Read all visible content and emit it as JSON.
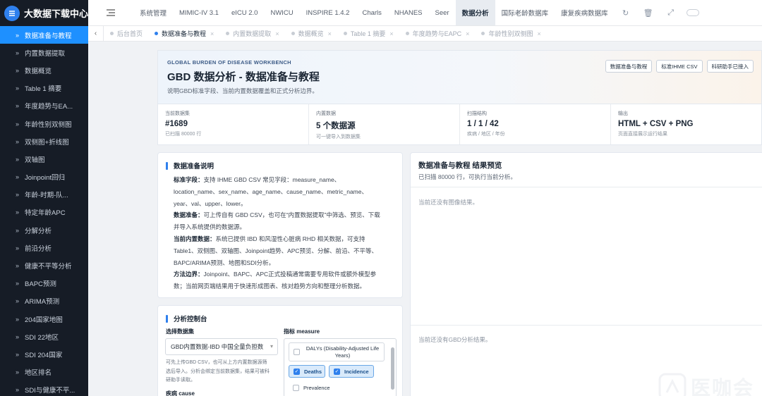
{
  "app": {
    "title": "大数据下载中心"
  },
  "sidebar": {
    "items": [
      {
        "label": "数据准备与教程",
        "active": true
      },
      {
        "label": "内置数据提取"
      },
      {
        "label": "数据概览"
      },
      {
        "label": "Table 1 摘要"
      },
      {
        "label": "年度趋势与EA..."
      },
      {
        "label": "年龄性别双侧图"
      },
      {
        "label": "双侧图+折线图"
      },
      {
        "label": "双轴图"
      },
      {
        "label": "Joinpoint回归"
      },
      {
        "label": "年龄-时期-队..."
      },
      {
        "label": "特定年龄APC"
      },
      {
        "label": "分解分析"
      },
      {
        "label": "前沿分析"
      },
      {
        "label": "健康不平等分析"
      },
      {
        "label": "BAPC预测"
      },
      {
        "label": "ARIMA预测"
      },
      {
        "label": "204国家地图"
      },
      {
        "label": "SDI 22地区"
      },
      {
        "label": "SDI 204国家"
      },
      {
        "label": "地区排名"
      },
      {
        "label": "SDI与健康不平..."
      }
    ]
  },
  "topnav": {
    "items": [
      {
        "label": "系统管理"
      },
      {
        "label": "MIMIC-IV 3.1"
      },
      {
        "label": "eICU 2.0"
      },
      {
        "label": "NWICU"
      },
      {
        "label": "INSPIRE 1.4.2"
      },
      {
        "label": "Charls"
      },
      {
        "label": "NHANES"
      },
      {
        "label": "Seer"
      },
      {
        "label": "数据分析",
        "active": true
      },
      {
        "label": "国际老龄数据库"
      },
      {
        "label": "康复疾病数据库"
      }
    ]
  },
  "tabs": [
    {
      "label": "后台首页"
    },
    {
      "label": "数据准备与教程",
      "active": true
    },
    {
      "label": "内置数据提取"
    },
    {
      "label": "数据概览"
    },
    {
      "label": "Table 1 摘要"
    },
    {
      "label": "年度趋势与EAPC"
    },
    {
      "label": "年龄性别双侧图"
    }
  ],
  "hero": {
    "eyebrow": "GLOBAL BURDEN OF DISEASE WORKBENCH",
    "title": "GBD 数据分析 - 数据准备与教程",
    "subtitle": "说明GBD标准字段、当前内置数据覆盖和正式分析边界。",
    "buttons": [
      "数据准备与教程",
      "标准IHME CSV",
      "科研助手已接入"
    ]
  },
  "stats": [
    {
      "label": "当前数据集",
      "value": "#1689",
      "note": "已扫描 80000 行"
    },
    {
      "label": "内置数据",
      "value": "5 个数据源",
      "note": "可一键导入到数据集"
    },
    {
      "label": "扫描结构",
      "value": "1 / 1 / 42",
      "note": "疾病 / 地区 / 年份"
    },
    {
      "label": "输出",
      "value": "HTML + CSV + PNG",
      "note": "页面直接展示运行结果"
    }
  ],
  "notes": {
    "title": "数据准备说明",
    "p1_head": "标准字段：",
    "p1_l1": "支持 IHME GBD CSV 常见字段：measure_name、",
    "p1_l2": "location_name、sex_name、age_name、cause_name、metric_name、",
    "p1_l3": "year、val、upper、lower。",
    "p2_head": "数据准备：",
    "p2_l1": "可上传自有 GBD CSV，也可在“内置数据提取”中筛选、预览、下载",
    "p2_l2": "并导入系统提供的数据源。",
    "p3_head": "当前内置数据：",
    "p3_l1": "系统已提供 IBD 和风湿性心脏病 RHD 相关数据，可支持",
    "p3_l2": "Table1、双侧图、双轴图、Joinpoint趋势、APC预览、分解、前沿、不平等、",
    "p3_l3": "BAPC/ARIMA预测、地图和SDI分析。",
    "p4_head": "方法边界：",
    "p4_l1": "Joinpoint、BAPC、APC正式投稿通常需要专用软件或额外模型参",
    "p4_l2": "数；当前网页端结果用于快速形成图表、核对趋势方向和整理分析数据。"
  },
  "control": {
    "title": "分析控制台",
    "dataset_label": "选择数据集",
    "dataset_value": "GBD内置数据-IBD 中国全量负担数",
    "dataset_hint": [
      "可先上传GBD CSV，也可从上方内置数据源筛",
      "选后导入。分析会绑定当前数据集，结果可被科",
      "研助手读取。"
    ],
    "cause_label": "疾病 cause",
    "metric_label": "指标 measure",
    "metrics": [
      {
        "label": "DALYs (Disability-Adjusted Life Years)",
        "checked": false
      },
      {
        "label": "Deaths",
        "checked": true
      },
      {
        "label": "Incidence",
        "checked": true
      },
      {
        "label": "Prevalence",
        "checked": false
      }
    ]
  },
  "preview": {
    "title": "数据准备与教程 结果预览",
    "subtitle": "已扫描 80000 行，可执行当前分析。",
    "empty_image": "当前还没有图像结果。",
    "empty_result": "当前还没有GBD分析结果。"
  },
  "watermark": {
    "text": "医咖会"
  },
  "colors": {
    "accent": "#2f80ed",
    "sidebar_bg": "#161c26",
    "active_item": "#1e90ff"
  }
}
